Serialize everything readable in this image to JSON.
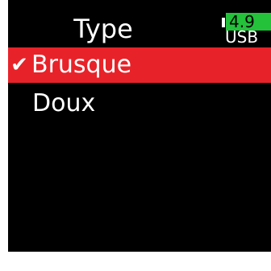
{
  "header": {
    "title": "Type",
    "battery": {
      "level_text": "4.9",
      "source": "USB",
      "level_color": "#23c23a"
    }
  },
  "menu": {
    "items": [
      {
        "label": "Brusque",
        "selected": true,
        "check_icon": "checkmark-icon"
      },
      {
        "label": "Doux",
        "selected": false
      }
    ],
    "selected_color": "#e82229"
  }
}
